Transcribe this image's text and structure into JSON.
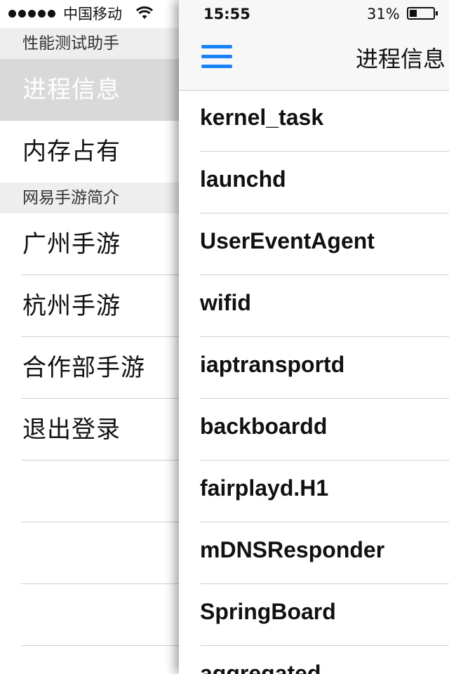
{
  "status_bar": {
    "carrier": "中国移动",
    "time": "15:55",
    "battery_percent": "31%",
    "battery_level": 0.31,
    "icons": [
      "signal-dots-icon",
      "wifi-icon",
      "battery-icon"
    ]
  },
  "drawer": {
    "section_performance": "性能测试助手",
    "item_process_info": "进程信息",
    "item_memory": "内存占有",
    "section_netease": "网易手游简介",
    "item_guangzhou": "广州手游",
    "item_hangzhou": "杭州手游",
    "item_partner": "合作部手游",
    "item_logout": "退出登录"
  },
  "navbar": {
    "title": "进程信息",
    "menu_icon": "hamburger-menu-icon",
    "accent_color": "#1a82f7"
  },
  "processes": [
    "kernel_task",
    "launchd",
    "UserEventAgent",
    "wifid",
    "iaptransportd",
    "backboardd",
    "fairplayd.H1",
    "mDNSResponder",
    "SpringBoard",
    "aggregated"
  ]
}
